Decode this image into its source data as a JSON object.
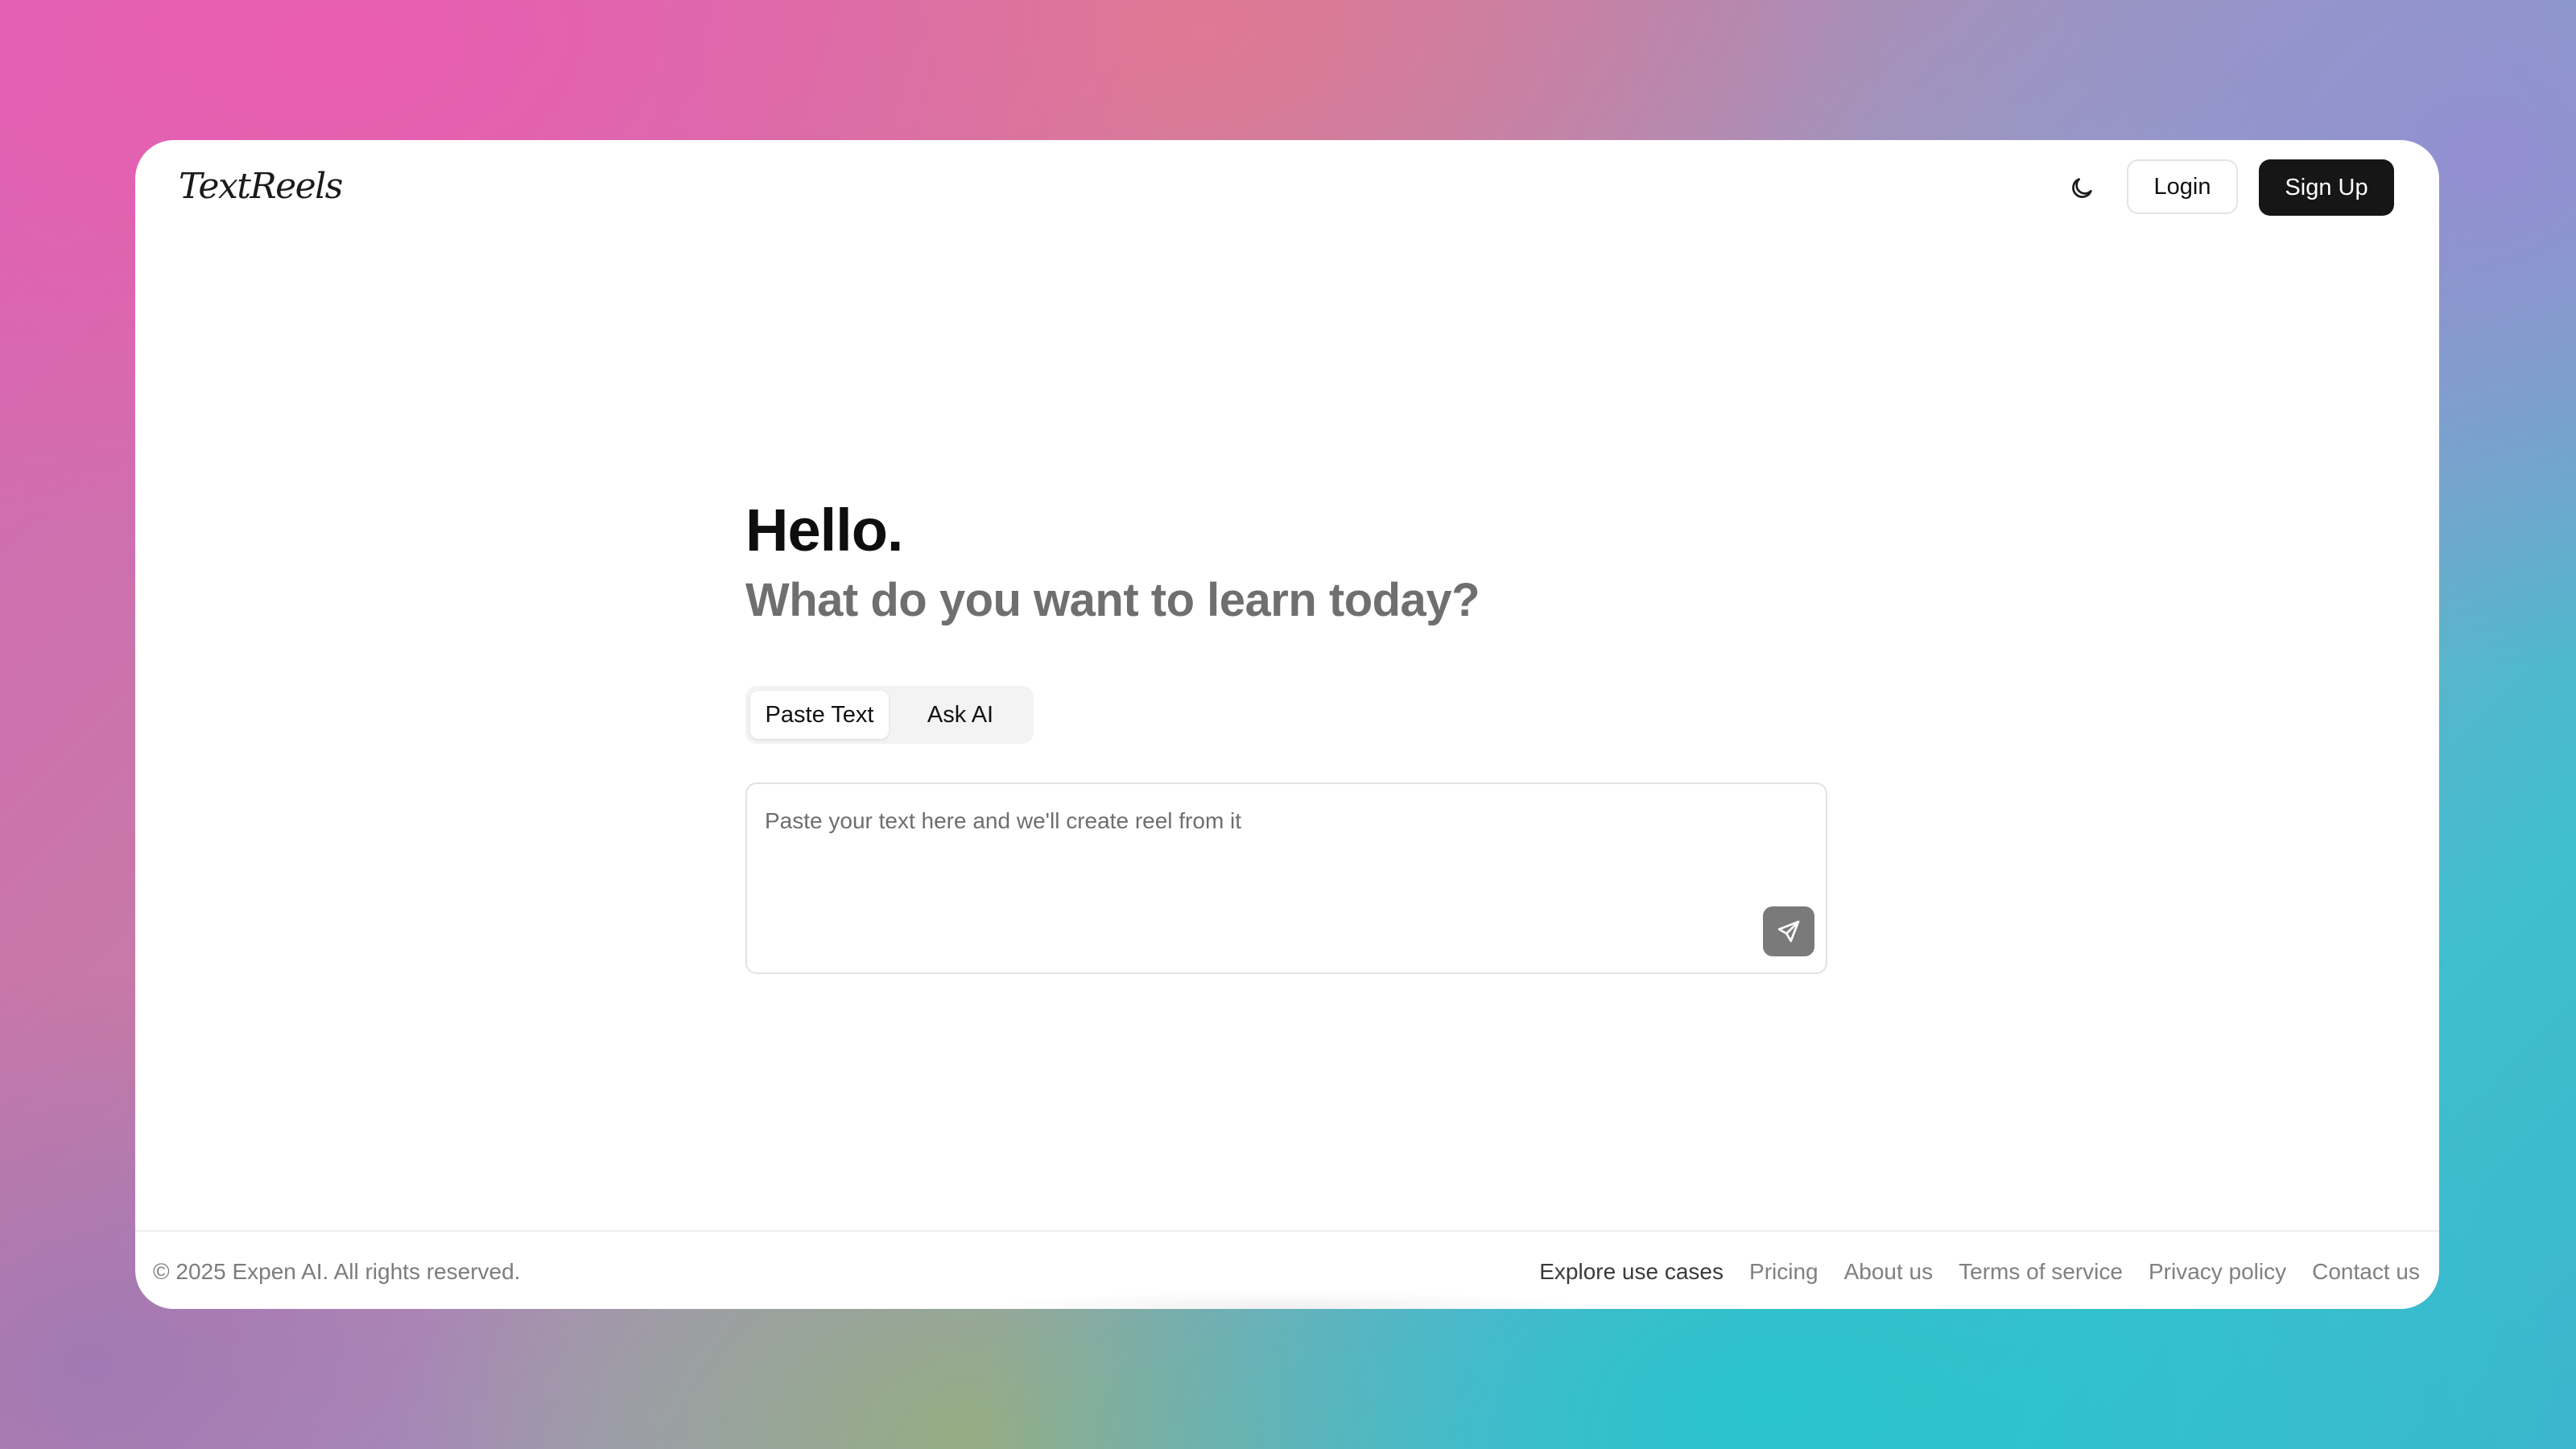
{
  "header": {
    "logo": "TextReels",
    "theme_icon": "moon-icon",
    "login_label": "Login",
    "signup_label": "Sign Up"
  },
  "hero": {
    "title": "Hello.",
    "subtitle": "What do you want to learn today?"
  },
  "tabs": [
    {
      "label": "Paste Text",
      "active": true
    },
    {
      "label": "Ask AI",
      "active": false
    }
  ],
  "input": {
    "placeholder": "Paste your text here and we'll create reel from it",
    "value": "",
    "send_icon": "send-icon"
  },
  "footer": {
    "copyright": "© 2025 Expen AI. All rights reserved.",
    "links": [
      "Explore use cases",
      "Pricing",
      "About us",
      "Terms of service",
      "Privacy policy",
      "Contact us"
    ]
  },
  "colors": {
    "primary_button": "#161616",
    "send_button": "#7a7a7a"
  }
}
